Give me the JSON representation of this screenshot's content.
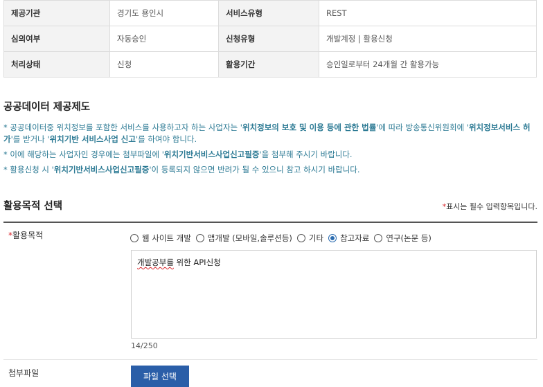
{
  "info": {
    "rows": [
      {
        "l1": "제공기관",
        "v1": "경기도 용인시",
        "l2": "서비스유형",
        "v2": "REST"
      },
      {
        "l1": "심의여부",
        "v1": "자동승인",
        "l2": "신청유형",
        "v2": "개발계정 | 활용신청"
      },
      {
        "l1": "처리상태",
        "v1": "신청",
        "l2": "활용기간",
        "v2": "승인일로부터 24개월 간 활용가능"
      }
    ]
  },
  "policy": {
    "title": "공공데이터 제공제도",
    "n1_a": "* 공공데이터중 위치정보를 포함한 서비스를 사용하고자 하는 사업자는 '",
    "n1_b": "위치정보의 보호 및 이용 등에 관한 법률",
    "n1_c": "'에 따라 방송통신위원회에 '",
    "n1_d": "위치정보서비스 허가",
    "n1_e": "'를 받거나 '",
    "n1_f": "위치기반 서비스사업 신고",
    "n1_g": "'를 하여야 합니다.",
    "n2_a": "* 이에 해당하는 사업자인 경우에는 첨부파일에 '",
    "n2_b": "위치기반서비스사업신고필증",
    "n2_c": "'을 첨부해 주시기 바랍니다.",
    "n3_a": "* 활용신청 시 '",
    "n3_b": "위치기반서비스사업신고필증",
    "n3_c": "'이 등록되지 않으면 반려가 될 수 있으니 참고 하시기 바랍니다."
  },
  "purpose": {
    "title": "활용목적 선택",
    "required_star": "*",
    "required_note": "표시는 필수 입력항목입니다.",
    "label": "활용목적",
    "options": [
      "웹 사이트 개발",
      "앱개발 (모바일,솔루션등)",
      "기타",
      "참고자료",
      "연구(논문 등)"
    ],
    "selected": "참고자료",
    "text_misspelled": "개발공부를",
    "text_rest": " 위한 API신청",
    "counter": "14/250"
  },
  "attach": {
    "label": "첨부파일",
    "button": "파일 선택"
  },
  "colors": {
    "accent": "#2a5ea8",
    "notice": "#2c7a94",
    "required": "#d9262c"
  }
}
